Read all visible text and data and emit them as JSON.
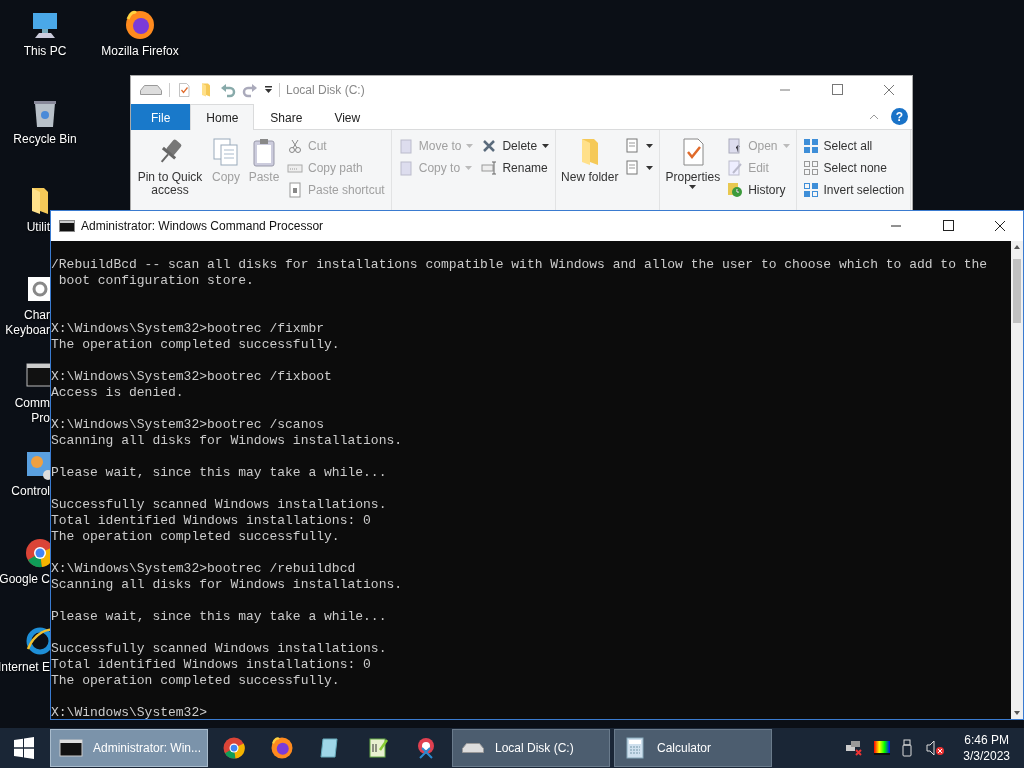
{
  "desktop": {
    "columns": [
      [
        {
          "lines": [
            "This PC"
          ]
        },
        {
          "lines": [
            "Recycle Bin"
          ]
        },
        {
          "lines": [
            "Utilit"
          ]
        },
        {
          "lines": [
            "Char",
            "Keyboar"
          ]
        },
        {
          "lines": [
            "Comm",
            "Pro"
          ]
        },
        {
          "lines": [
            "Control"
          ]
        },
        {
          "lines": [
            "Google C"
          ]
        },
        {
          "lines": [
            "Internet E"
          ]
        }
      ],
      [
        {
          "lines": [
            "Mozilla Firefox"
          ]
        }
      ]
    ]
  },
  "explorer": {
    "title": "Local Disk (C:)",
    "help": "?",
    "tabs": [
      {
        "label": "File",
        "kind": "file",
        "selected": false
      },
      {
        "label": "Home",
        "kind": "tab",
        "selected": true
      },
      {
        "label": "Share",
        "kind": "tab",
        "selected": false
      },
      {
        "label": "View",
        "kind": "tab",
        "selected": false
      }
    ],
    "groups": [
      [
        {
          "kind": "large",
          "label": "Pin to Quick access",
          "disabled": false
        },
        {
          "kind": "large",
          "label": "Copy",
          "disabled": true
        },
        {
          "kind": "large",
          "label": "Paste",
          "disabled": true
        },
        {
          "kind": "stack",
          "items": [
            {
              "label": "Cut",
              "disabled": true,
              "dropdown": false
            },
            {
              "label": "Copy path",
              "disabled": true,
              "dropdown": false
            },
            {
              "label": "Paste shortcut",
              "disabled": true,
              "dropdown": false
            }
          ]
        }
      ],
      [
        {
          "kind": "stack",
          "items": [
            {
              "label": "Move to",
              "disabled": true,
              "dropdown": true
            },
            {
              "label": "Copy to",
              "disabled": true,
              "dropdown": true
            }
          ]
        },
        {
          "kind": "stack",
          "items": [
            {
              "label": "Delete",
              "disabled": false,
              "dropdown": true
            },
            {
              "label": "Rename",
              "disabled": false,
              "dropdown": false
            }
          ]
        }
      ],
      [
        {
          "kind": "large",
          "label": "New folder",
          "disabled": false
        },
        {
          "kind": "stack",
          "items": [
            {
              "disabled": false,
              "dropdown": true
            },
            {
              "disabled": false,
              "dropdown": true
            }
          ]
        }
      ],
      [
        {
          "kind": "large",
          "label": "Properties",
          "disabled": false,
          "dropdown": true
        },
        {
          "kind": "stack",
          "items": [
            {
              "label": "Open",
              "disabled": true,
              "dropdown": true
            },
            {
              "label": "Edit",
              "disabled": true,
              "dropdown": false
            },
            {
              "label": "History",
              "disabled": false,
              "dropdown": false
            }
          ]
        }
      ],
      [
        {
          "kind": "stack",
          "items": [
            {
              "label": "Select all",
              "disabled": false,
              "dropdown": false
            },
            {
              "label": "Select none",
              "disabled": false,
              "dropdown": false
            },
            {
              "label": "Invert selection",
              "disabled": false,
              "dropdown": false
            }
          ]
        }
      ]
    ]
  },
  "console": {
    "title": "Administrator: Windows Command Processor",
    "output": "/RebuildBcd -- scan all disks for installations compatible with Windows and allow the user to choose which to add to the\n boot configuration store.\n\n\nX:\\Windows\\System32>bootrec /fixmbr\nThe operation completed successfully.\n\nX:\\Windows\\System32>bootrec /fixboot\nAccess is denied.\n\nX:\\Windows\\System32>bootrec /scanos\nScanning all disks for Windows installations.\n\nPlease wait, since this may take a while...\n\nSuccessfully scanned Windows installations.\nTotal identified Windows installations: 0\nThe operation completed successfully.\n\nX:\\Windows\\System32>bootrec /rebuildbcd\nScanning all disks for Windows installations.\n\nPlease wait, since this may take a while...\n\nSuccessfully scanned Windows installations.\nTotal identified Windows installations: 0\nThe operation completed successfully.\n\nX:\\Windows\\System32>"
  },
  "taskbar": {
    "tasks": [
      {
        "label": "Administrator: Win...",
        "selected": true
      },
      {
        "label": "Local Disk (C:)",
        "selected": false
      },
      {
        "label": "Calculator",
        "selected": false
      }
    ],
    "clock": {
      "time": "6:46 PM",
      "date": "3/3/2023"
    }
  }
}
